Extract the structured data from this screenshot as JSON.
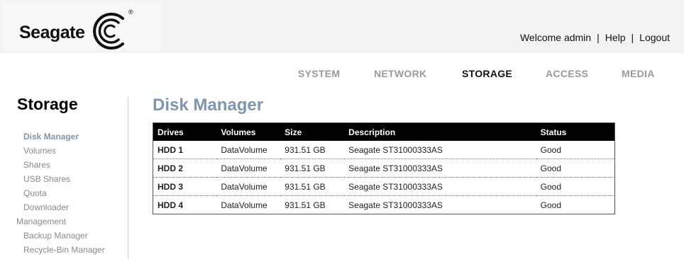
{
  "brand": {
    "name": "Seagate",
    "reg": "®"
  },
  "user_links": {
    "welcome": "Welcome admin",
    "sep": "|",
    "help": "Help",
    "logout": "Logout"
  },
  "main_nav": [
    "SYSTEM",
    "NETWORK",
    "STORAGE",
    "ACCESS",
    "MEDIA"
  ],
  "active_nav": "STORAGE",
  "sidebar": {
    "title": "Storage",
    "items": [
      "Disk Manager",
      "Volumes",
      "Shares",
      "USB Shares",
      "Quota",
      "Downloader"
    ],
    "group": "Management",
    "group_items": [
      "Backup Manager",
      "Recycle-Bin Manager"
    ]
  },
  "page_title": "Disk Manager",
  "table": {
    "columns": [
      "Drives",
      "Volumes",
      "Size",
      "Description",
      "Status"
    ],
    "rows": [
      [
        "HDD 1",
        "DataVolume",
        "931.51 GB",
        "Seagate ST31000333AS",
        "Good"
      ],
      [
        "HDD 2",
        "DataVolume",
        "931.51 GB",
        "Seagate ST31000333AS",
        "Good"
      ],
      [
        "HDD 3",
        "DataVolume",
        "931.51 GB",
        "Seagate ST31000333AS",
        "Good"
      ],
      [
        "HDD 4",
        "DataVolume",
        "931.51 GB",
        "Seagate ST31000333AS",
        "Good"
      ]
    ]
  }
}
